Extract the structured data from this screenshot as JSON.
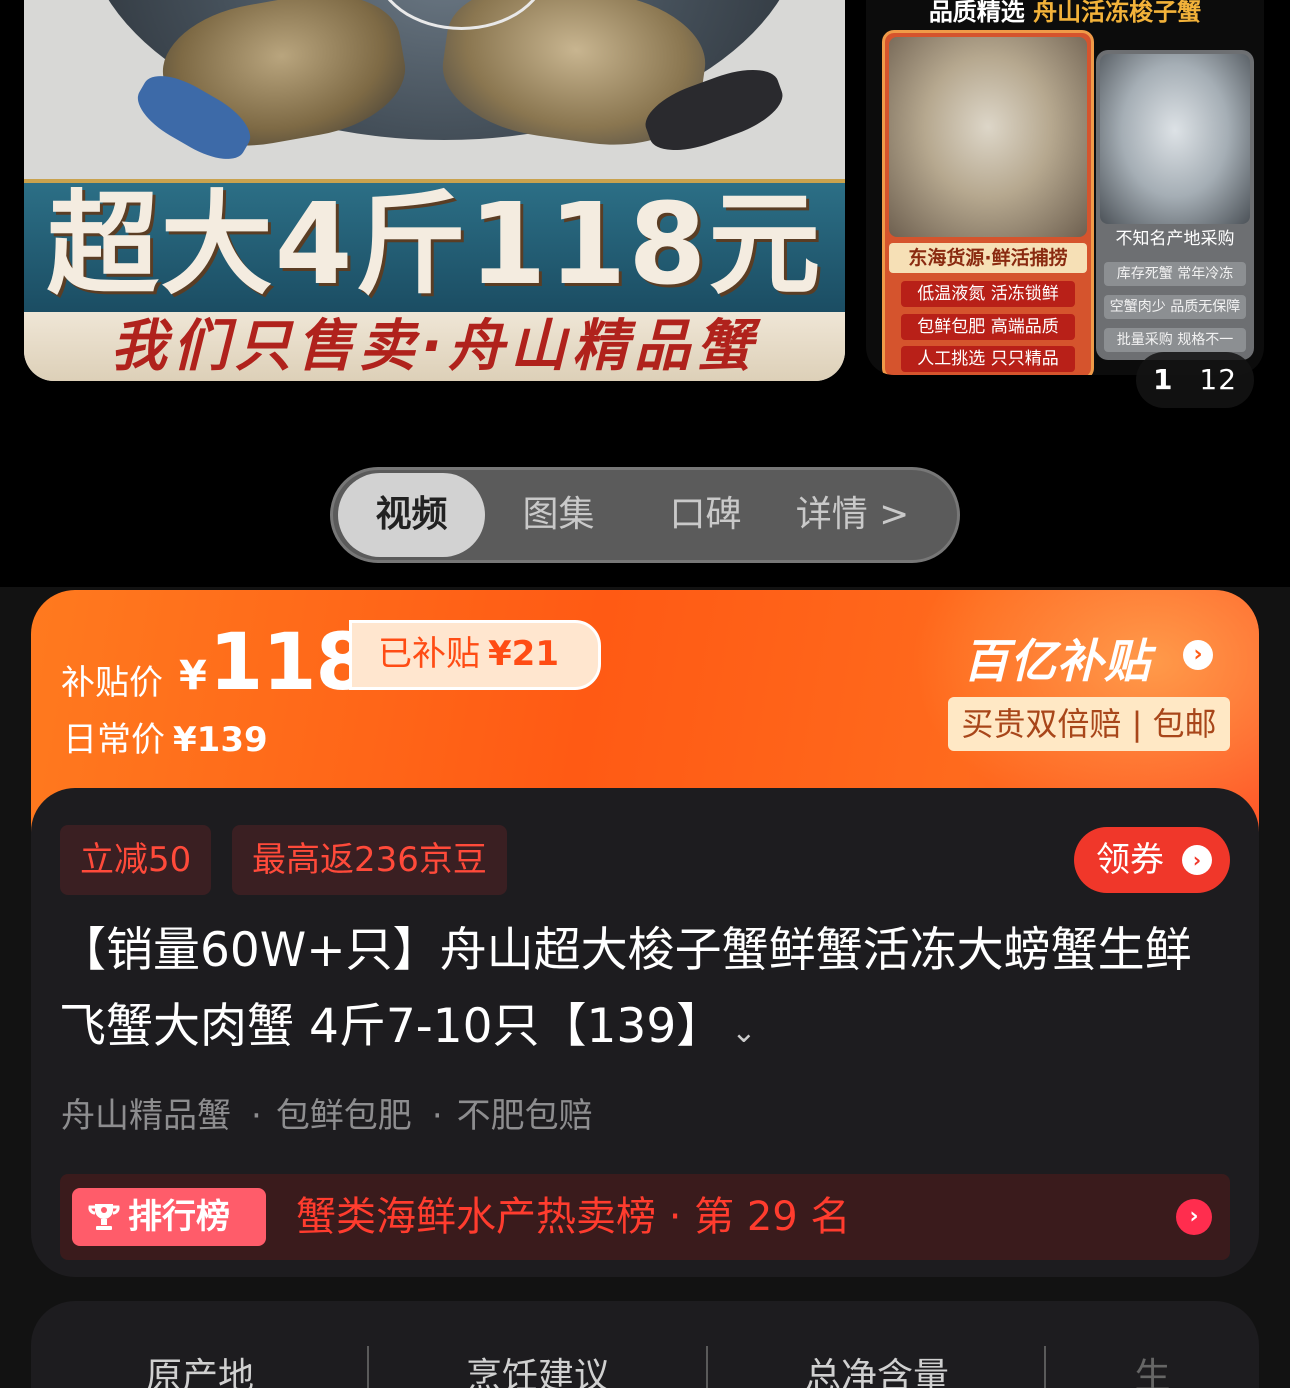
{
  "gallery": {
    "main_banner_headline": "超大4斤118元",
    "main_banner_slogan": "我们只售卖·舟山精品蟹",
    "side_header_prefix": "品质精选",
    "side_header_highlight": "舟山活冻梭子蟹",
    "card_a": {
      "title": "东海货源·鲜活捕捞",
      "tags": [
        "低温液氮 活冻锁鲜",
        "包鲜包肥 高端品质",
        "人工挑选 只只精品"
      ]
    },
    "card_b": {
      "title": "不知名产地采购",
      "tags": [
        "库存死蟹 常年冷冻",
        "空蟹肉少 品质无保障",
        "批量采购 规格不一"
      ]
    },
    "pager": {
      "current": "1",
      "total": "12"
    }
  },
  "media_tabs": [
    {
      "label": "视频",
      "active": true
    },
    {
      "label": "图集",
      "active": false
    },
    {
      "label": "口碑",
      "active": false
    },
    {
      "label": "详情 >",
      "active": false
    }
  ],
  "price": {
    "subsidy_label": "补贴价",
    "currency": "¥",
    "subsidy_price": "118",
    "subsidy_tag": "已补贴",
    "subsidy_amount": "¥21",
    "daily_label": "日常价",
    "daily_price": "¥139",
    "brand": "百亿补贴",
    "guarantee": "买贵双倍赔 | 包邮"
  },
  "promos": {
    "chips": [
      "立减50",
      "最高返236京豆"
    ],
    "coupon_label": "领券"
  },
  "product": {
    "title": "【销量60W+只】舟山超大梭子蟹鲜蟹活冻大螃蟹生鲜飞蟹大肉蟹 4斤7-10只【139】",
    "features": [
      "舟山精品蟹",
      "包鲜包肥",
      "不肥包赔"
    ]
  },
  "ranking": {
    "badge": "排行榜",
    "text": "蟹类海鲜水产热卖榜 · 第 29 名"
  },
  "specs": [
    "原产地",
    "烹饪建议",
    "总净含量",
    "生"
  ],
  "colors": {
    "accent_orange": "#ff5a14",
    "coupon_red": "#f0372a",
    "rank_red": "#ff3c2e"
  }
}
